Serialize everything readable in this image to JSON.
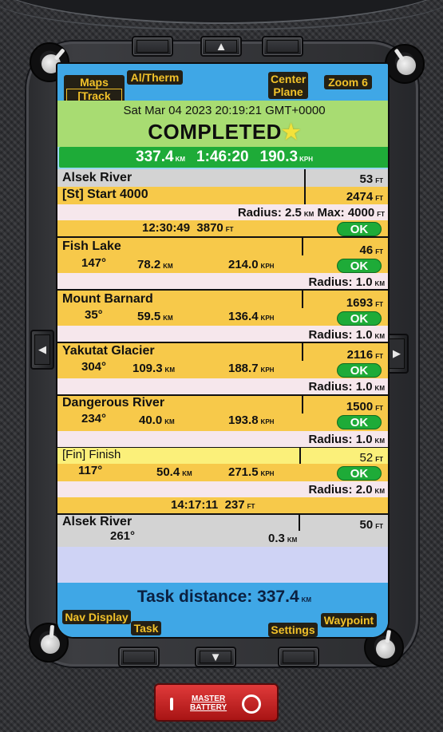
{
  "topbar": {
    "maps_line1": "Maps",
    "maps_line2": "[Track Up]",
    "al_therm": "Al/Therm",
    "center_line1": "Center",
    "center_line2": "Plane",
    "zoom": "Zoom 6"
  },
  "header": {
    "datetime": "Sat Mar 04 2023 20:19:21 GMT+0000",
    "status": "COMPLETED",
    "star_icon": "star-icon"
  },
  "stats": {
    "distance": "337.4",
    "distance_unit": "KM",
    "time": "1:46:20",
    "speed": "190.3",
    "speed_unit": "KPH"
  },
  "waypoints": [
    {
      "name": "Alsek River",
      "alt": "53",
      "alt_unit": "FT"
    },
    {
      "name": "[St] Start 4000",
      "alt": "2474",
      "alt_unit": "FT",
      "radius": "Radius: 2.5",
      "radius_unit": "KM",
      "max": "Max: 4000",
      "max_unit": "FT",
      "time": "12:30:49",
      "time_alt": "3870",
      "time_alt_unit": "FT",
      "ok": "OK"
    },
    {
      "name": "Fish Lake",
      "bearing": "147°",
      "dist": "78.2",
      "dist_unit": "KM",
      "speed": "214.0",
      "speed_unit": "KPH",
      "alt": "46",
      "alt_unit": "FT",
      "ok": "OK",
      "radius": "Radius: 1.0",
      "radius_unit": "KM"
    },
    {
      "name": "Mount Barnard",
      "bearing": "35°",
      "dist": "59.5",
      "dist_unit": "KM",
      "speed": "136.4",
      "speed_unit": "KPH",
      "alt": "1693",
      "alt_unit": "FT",
      "ok": "OK",
      "radius": "Radius: 1.0",
      "radius_unit": "KM"
    },
    {
      "name": "Yakutat Glacier",
      "bearing": "304°",
      "dist": "109.3",
      "dist_unit": "KM",
      "speed": "188.7",
      "speed_unit": "KPH",
      "alt": "2116",
      "alt_unit": "FT",
      "ok": "OK",
      "radius": "Radius: 1.0",
      "radius_unit": "KM"
    },
    {
      "name": "Dangerous River",
      "bearing": "234°",
      "dist": "40.0",
      "dist_unit": "KM",
      "speed": "193.8",
      "speed_unit": "KPH",
      "alt": "1500",
      "alt_unit": "FT",
      "ok": "OK",
      "radius": "Radius: 1.0",
      "radius_unit": "KM"
    },
    {
      "name": "[Fin] Finish",
      "bearing": "117°",
      "dist": "50.4",
      "dist_unit": "KM",
      "speed": "271.5",
      "speed_unit": "KPH",
      "alt": "52",
      "alt_unit": "FT",
      "ok": "OK",
      "radius": "Radius: 2.0",
      "radius_unit": "KM",
      "time": "14:17:11",
      "time_alt": "237",
      "time_alt_unit": "FT"
    },
    {
      "name": "Alsek River",
      "bearing": "261°",
      "dist": "0.3",
      "dist_unit": "KM",
      "alt": "50",
      "alt_unit": "FT"
    }
  ],
  "footer": {
    "task_distance": "Task distance: 337.4",
    "task_distance_unit": "KM",
    "nav_display": "Nav Display",
    "task": "Task",
    "settings": "Settings",
    "waypoint": "Waypoint"
  },
  "hardware": {
    "up_arrow": "▲",
    "down_arrow": "▼",
    "left_arrow": "◀",
    "right_arrow": "▶",
    "master_line1": "MASTER",
    "master_line2": "BATTERY"
  },
  "colors": {
    "orange_row": "#f7c94a",
    "grey_row": "#d3d3d3",
    "pink_row": "#f6e7ec",
    "yellow_finish": "#fbf07a",
    "ok_green": "#1eab38",
    "header_green": "#a8dc72",
    "screen_blue": "#3fa7e6"
  }
}
